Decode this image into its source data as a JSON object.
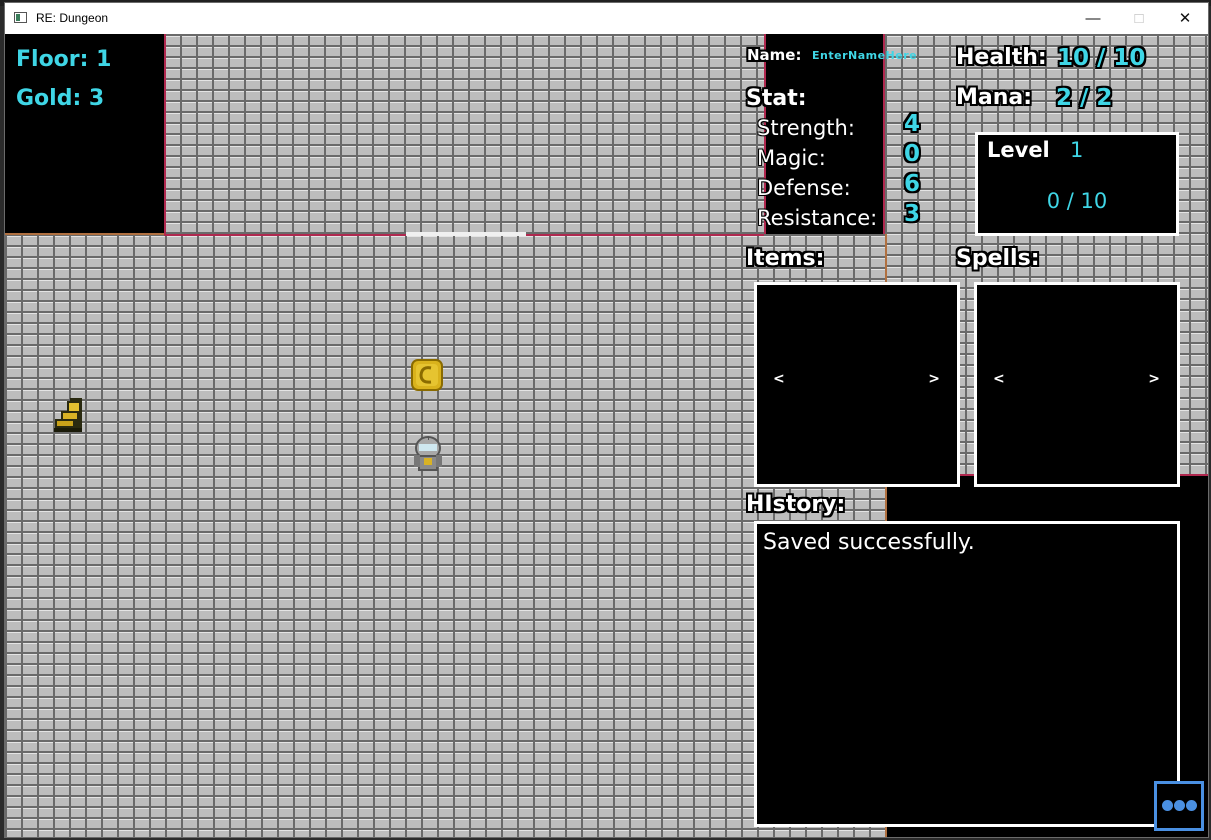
{
  "window": {
    "title": "RE: Dungeon"
  },
  "hud": {
    "floor_label": "Floor: 1",
    "gold_label": "Gold: 3",
    "name_label": "Name:",
    "name_value": "EnterNameHere",
    "health_label": "Health:",
    "health_value": "10 / 10",
    "mana_label": "Mana:",
    "mana_value": "2 / 2",
    "stat_label": "Stat:",
    "stats": [
      {
        "label": "Strength:",
        "value": "4"
      },
      {
        "label": "Magic:",
        "value": "0"
      },
      {
        "label": "Defense:",
        "value": "6"
      },
      {
        "label": "Resistance:",
        "value": "3"
      }
    ],
    "level_label": "Level",
    "level_value": "1",
    "xp_value": "0 / 10",
    "items_label": "Items:",
    "spells_label": "Spells:",
    "prev_arrow": "<",
    "next_arrow": ">",
    "history_label": "HIstory:",
    "history_lines": [
      "Saved successfully."
    ]
  },
  "sprites": [
    "stairs-icon",
    "gold-coin-icon",
    "player-knight-icon"
  ],
  "colors": {
    "accent": "#3fd6e6",
    "menu": "#4a90e2",
    "border_red": "#b0284f"
  }
}
